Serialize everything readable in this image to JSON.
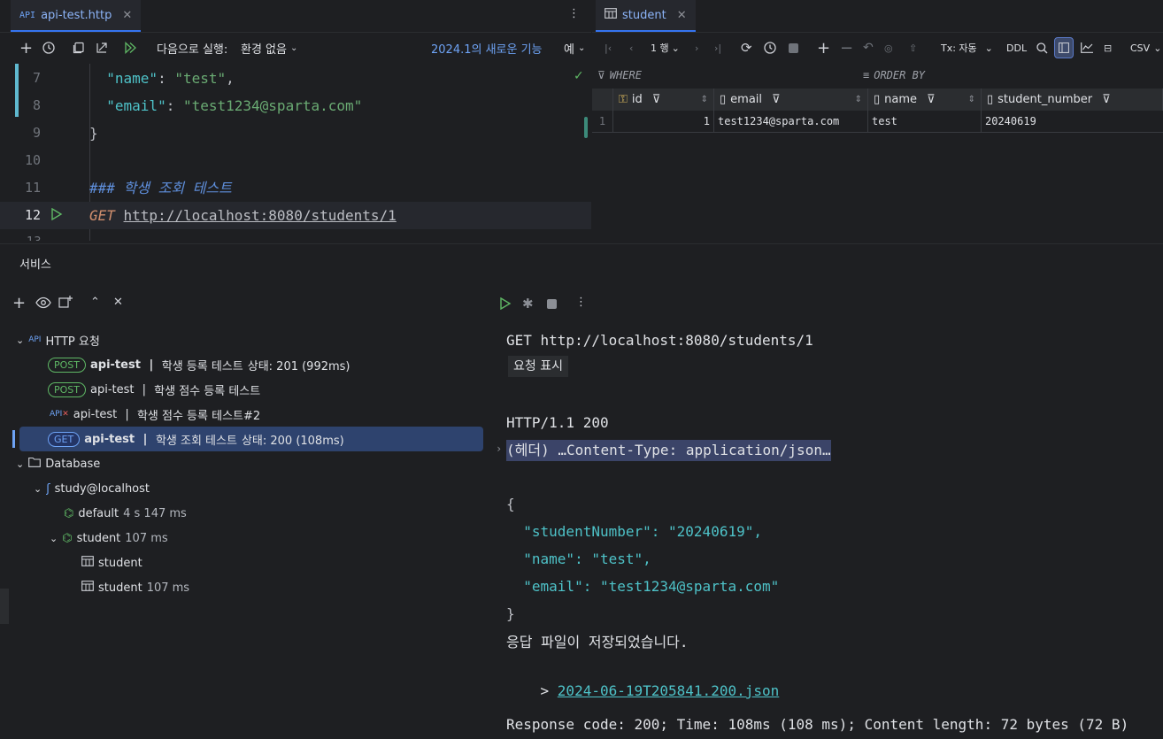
{
  "editor": {
    "tab": {
      "icon_label": "API",
      "file": "api-test.http"
    },
    "toolbar": {
      "run_with_label": "다음으로 실행:",
      "env_value": "환경 없음",
      "whats_new": "2024.1의 새로운 기능",
      "example": "예"
    },
    "lines": [
      {
        "num": "7",
        "parts": [
          {
            "t": "  \"name\"",
            "c": "key"
          },
          {
            "t": ": ",
            "c": "txt"
          },
          {
            "t": "\"test\"",
            "c": "str"
          },
          {
            "t": ",",
            "c": "txt"
          }
        ]
      },
      {
        "num": "8",
        "parts": [
          {
            "t": "  \"email\"",
            "c": "key"
          },
          {
            "t": ": ",
            "c": "txt"
          },
          {
            "t": "\"test1234@sparta.com\"",
            "c": "str"
          }
        ]
      },
      {
        "num": "9",
        "parts": [
          {
            "t": "}",
            "c": "txt"
          }
        ]
      },
      {
        "num": "10",
        "parts": []
      },
      {
        "num": "11",
        "parts": [
          {
            "t": "### 학생 조회 테스트",
            "c": "comment"
          }
        ]
      },
      {
        "num": "12",
        "parts": [
          {
            "t": "GET ",
            "c": "kw"
          },
          {
            "t": "http://localhost:8080/students/1",
            "c": "url"
          }
        ]
      }
    ]
  },
  "db": {
    "tab": "student",
    "toolbar": {
      "rows": "1 행",
      "tx": "Tx: 자동",
      "ddl": "DDL",
      "export": "CSV"
    },
    "where": "WHERE",
    "order_by": "ORDER BY",
    "columns": [
      "id",
      "email",
      "name",
      "student_number"
    ],
    "rows": [
      {
        "row_num": "1",
        "id": "1",
        "email": "test1234@sparta.com",
        "name": "test",
        "student_number": "20240619"
      }
    ]
  },
  "services": {
    "title": "서비스",
    "http_group": "HTTP 요청",
    "requests": [
      {
        "method": "POST",
        "file": "api-test",
        "sep": " | ",
        "title": "학생 등록 테스트",
        "status": "상태: 201 (992ms)",
        "bold": true
      },
      {
        "method": "POST",
        "file": "api-test",
        "sep": " | ",
        "title": "학생 점수 등록 테스트",
        "status": "",
        "bold": false
      },
      {
        "method": "",
        "file": "api-test",
        "sep": " | ",
        "title": "학생 점수 등록 테스트#2",
        "status": "",
        "bold": false
      },
      {
        "method": "GET",
        "file": "api-test",
        "sep": " | ",
        "title": "학생 조회 테스트",
        "status": "상태: 200 (108ms)",
        "bold": true
      }
    ],
    "db_group": "Database",
    "connection": "study@localhost",
    "sessions": [
      {
        "name": "default",
        "time": "4 s 147 ms"
      },
      {
        "name": "student",
        "time": "107 ms"
      }
    ],
    "children": [
      {
        "name": "student",
        "time": ""
      },
      {
        "name": "student",
        "time": "107 ms"
      }
    ]
  },
  "console": {
    "request_line": "GET http://localhost:8080/students/1",
    "show_request": "요청 표시",
    "status_line": "HTTP/1.1 200",
    "headers_line": "(헤더) …Content-Type: application/json…",
    "json_lines": [
      "{",
      "  \"studentNumber\": \"20240619\",",
      "  \"name\": \"test\",",
      "  \"email\": \"test1234@sparta.com\"",
      "}"
    ],
    "saved_msg": "응답 파일이 저장되었습니다.",
    "file_prefix": "> ",
    "file_link": "2024-06-19T205841.200.json",
    "summary": "Response code: 200; Time: 108ms (108 ms); Content length: 72 bytes (72 B)"
  }
}
